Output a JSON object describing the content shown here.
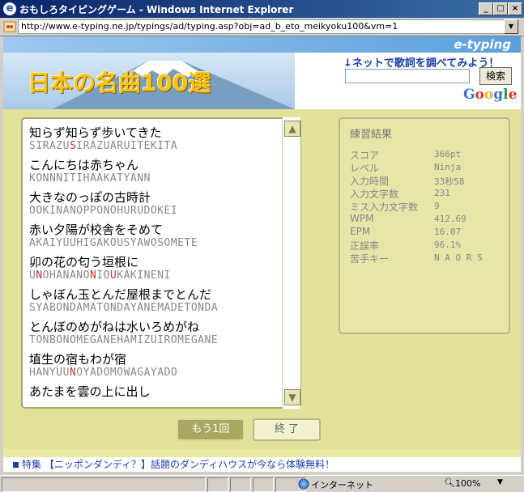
{
  "window": {
    "title": "おもしろタイピングゲーム - Windows Internet Explorer"
  },
  "address": {
    "url": "http://www.e-typing.ne.jp/typings/ad/typing.asp?obj=ad_b_eto_meikyoku100&vm=1"
  },
  "header": {
    "brand": "e-typing",
    "title": "日本の名曲100選",
    "lyric_link": "↓ネットで歌詞を調べてみよう！",
    "search_button": "検索",
    "google": "Google"
  },
  "lyrics": [
    {
      "kanji": "知らず知らず歩いてきた",
      "roman": "SIRAZUSIRAZUARUITEKITA"
    },
    {
      "kanji": "こんにちは赤ちゃん",
      "roman": "KONNNITIHAAKATYANN"
    },
    {
      "kanji": "大きなのっぽの古時計",
      "roman": "OOKINANOPPONOHURUDOKEI"
    },
    {
      "kanji": "赤い夕陽が校舎をそめて",
      "roman": "AKAIYUUHIGAKOUSYAWOSOMETE"
    },
    {
      "kanji": "卯の花の匂う垣根に",
      "roman": "UNOHANANONIOUKAKINENI"
    },
    {
      "kanji": "しゃぼん玉とんだ屋根までとんだ",
      "roman": "SYABONDAMATONDAYANEMADETONDA"
    },
    {
      "kanji": "とんぼのめがねは水いろめがね",
      "roman": "TONBONOMEGANEHAMIZUIROMEGANE"
    },
    {
      "kanji": "埴生の宿もわが宿",
      "roman": "HANYUUNOYADOMOWAGAYADO"
    },
    {
      "kanji": "あたまを雲の上に出し",
      "roman": ""
    }
  ],
  "stats": {
    "title": "練習結果",
    "rows": [
      {
        "label": "スコア",
        "value": "366pt"
      },
      {
        "label": "レベル",
        "value": "Ninja"
      },
      {
        "label": "入力時間",
        "value": "33秒58"
      },
      {
        "label": "入力文字数",
        "value": "231"
      },
      {
        "label": "ミス入力文字数",
        "value": "9"
      },
      {
        "label": "WPM",
        "value": "412.69"
      },
      {
        "label": "EPM",
        "value": "16.07"
      },
      {
        "label": "正誤率",
        "value": "96.1%"
      },
      {
        "label": "苦手キー",
        "value": "N A O R S"
      }
    ]
  },
  "buttons": {
    "retry": "もう1回",
    "end": "終 了"
  },
  "promo": "特集 【ニッポンダンディ？】話題のダンディハウスが今なら体験無料！",
  "status": {
    "zone": "インターネット",
    "zoom": "100%"
  },
  "colors": {
    "accent": "#1a3fa8",
    "miss": "#cc3333",
    "panel": "#e2e29a"
  }
}
